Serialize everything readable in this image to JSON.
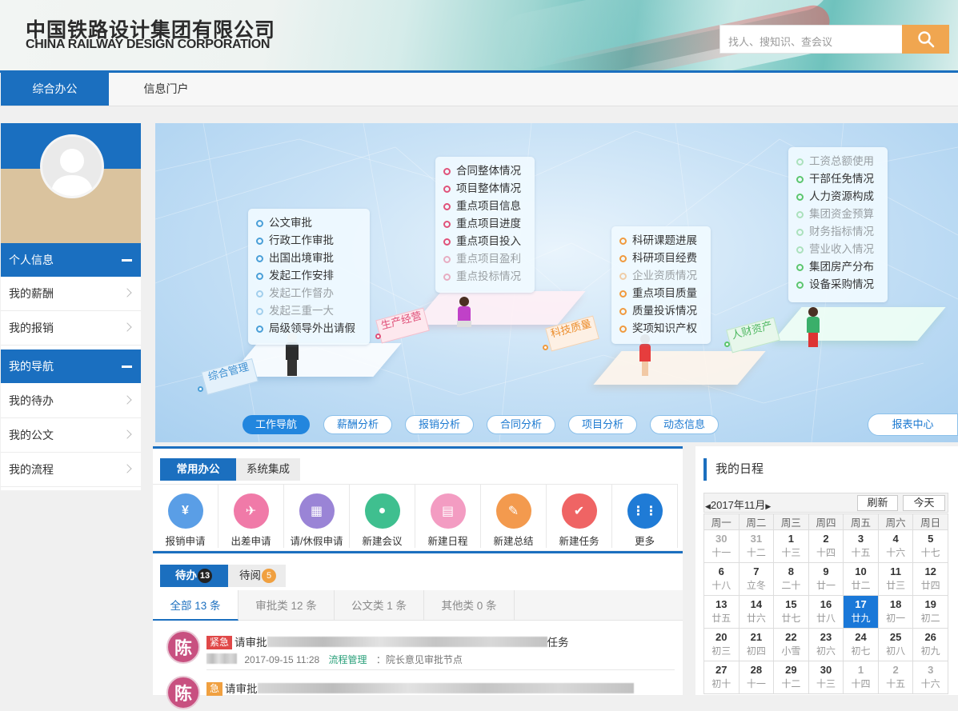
{
  "header": {
    "logo_cn": "中国铁路设计集团有限公司",
    "logo_en": "CHINA RAILWAY DESIGN CORPORATION",
    "search_placeholder": "找人、搜知识、查会议"
  },
  "nav": {
    "tabs": [
      "综合办公",
      "信息门户"
    ]
  },
  "sidebar": {
    "personal_title": "个人信息",
    "personal_items": [
      "我的薪酬",
      "我的报销"
    ],
    "nav_title": "我的导航",
    "nav_items": [
      "我的待办",
      "我的公文",
      "我的流程"
    ]
  },
  "banner": {
    "zones": [
      {
        "label": "综合管理",
        "color": "#4a9fd8",
        "items": [
          {
            "text": "公文审批",
            "faded": false
          },
          {
            "text": "行政工作审批",
            "faded": false
          },
          {
            "text": "出国出境审批",
            "faded": false
          },
          {
            "text": "发起工作安排",
            "faded": false
          },
          {
            "text": "发起工作督办",
            "faded": true
          },
          {
            "text": "发起三重一大",
            "faded": true
          },
          {
            "text": "局级领导外出请假",
            "faded": false
          }
        ]
      },
      {
        "label": "生产经营",
        "color": "#e0527a",
        "items": [
          {
            "text": "合同整体情况",
            "faded": false
          },
          {
            "text": "项目整体情况",
            "faded": false
          },
          {
            "text": "重点项目信息",
            "faded": false
          },
          {
            "text": "重点项目进度",
            "faded": false
          },
          {
            "text": "重点项目投入",
            "faded": false
          },
          {
            "text": "重点项目盈利",
            "faded": true
          },
          {
            "text": "重点投标情况",
            "faded": true
          }
        ]
      },
      {
        "label": "科技质量",
        "color": "#f09a3e",
        "items": [
          {
            "text": "科研课题进展",
            "faded": false
          },
          {
            "text": "科研项目经费",
            "faded": false
          },
          {
            "text": "企业资质情况",
            "faded": true
          },
          {
            "text": "重点项目质量",
            "faded": false
          },
          {
            "text": "质量投诉情况",
            "faded": false
          },
          {
            "text": "奖项知识产权",
            "faded": false
          }
        ]
      },
      {
        "label": "人财资产",
        "color": "#5cc66e",
        "items": [
          {
            "text": "工资总额使用",
            "faded": true
          },
          {
            "text": "干部任免情况",
            "faded": false
          },
          {
            "text": "人力资源构成",
            "faded": false
          },
          {
            "text": "集团资金预算",
            "faded": true
          },
          {
            "text": "财务指标情况",
            "faded": true
          },
          {
            "text": "营业收入情况",
            "faded": true
          },
          {
            "text": "集团房产分布",
            "faded": false
          },
          {
            "text": "设备采购情况",
            "faded": false
          }
        ]
      }
    ],
    "tabs": [
      "工作导航",
      "薪酬分析",
      "报销分析",
      "合同分析",
      "项目分析",
      "动态信息",
      "报表中心"
    ]
  },
  "office": {
    "tabs": [
      "常用办公",
      "系统集成"
    ],
    "actions": [
      {
        "label": "报销申请",
        "icon": "reimbursement-icon",
        "glyph": "¥",
        "color": "#5a9ee6"
      },
      {
        "label": "出差申请",
        "icon": "airplane-icon",
        "glyph": "✈",
        "color": "#f07aa8"
      },
      {
        "label": "请/休假申请",
        "icon": "calendar-leave-icon",
        "glyph": "▦",
        "color": "#9a84d6"
      },
      {
        "label": "新建会议",
        "icon": "meeting-icon",
        "glyph": "●",
        "color": "#3fbf8f"
      },
      {
        "label": "新建日程",
        "icon": "schedule-icon",
        "glyph": "▤",
        "color": "#f39cc2"
      },
      {
        "label": "新建总结",
        "icon": "summary-icon",
        "glyph": "✎",
        "color": "#f39a4e"
      },
      {
        "label": "新建任务",
        "icon": "task-icon",
        "glyph": "✔",
        "color": "#ef6464"
      },
      {
        "label": "更多",
        "icon": "more-grid-icon",
        "glyph": "⋮⋮",
        "color": "#1f7bd6"
      }
    ]
  },
  "todo": {
    "tabs": [
      {
        "label": "待办",
        "count": "13"
      },
      {
        "label": "待阅",
        "count": "5"
      }
    ],
    "filters": [
      "全部 13 条",
      "审批类 12 条",
      "公文类 1 条",
      "其他类 0 条"
    ],
    "items": [
      {
        "avatar": "陈",
        "tag": "紧急",
        "tag_color": "#e04848",
        "title_prefix": "请审批",
        "title_suffix": "任务",
        "date": "2017-09-15 11:28",
        "category": "流程管理",
        "node": "：院长意见审批节点"
      },
      {
        "avatar": "陈",
        "tag": "急",
        "tag_color": "#f0a040",
        "title_prefix": "请审批",
        "title_suffix": "",
        "date": "",
        "category": "",
        "node": ""
      }
    ]
  },
  "schedule": {
    "title": "我的日程",
    "month": "2017年11月",
    "refresh_label": "刷新",
    "today_label": "今天",
    "weekdays": [
      "周一",
      "周二",
      "周三",
      "周四",
      "周五",
      "周六",
      "周日"
    ],
    "weeks": [
      [
        {
          "d": "30",
          "l": "十一",
          "o": true
        },
        {
          "d": "31",
          "l": "十二",
          "o": true
        },
        {
          "d": "1",
          "l": "十三"
        },
        {
          "d": "2",
          "l": "十四"
        },
        {
          "d": "3",
          "l": "十五"
        },
        {
          "d": "4",
          "l": "十六"
        },
        {
          "d": "5",
          "l": "十七"
        }
      ],
      [
        {
          "d": "6",
          "l": "十八"
        },
        {
          "d": "7",
          "l": "立冬"
        },
        {
          "d": "8",
          "l": "二十"
        },
        {
          "d": "9",
          "l": "廿一"
        },
        {
          "d": "10",
          "l": "廿二"
        },
        {
          "d": "11",
          "l": "廿三"
        },
        {
          "d": "12",
          "l": "廿四"
        }
      ],
      [
        {
          "d": "13",
          "l": "廿五"
        },
        {
          "d": "14",
          "l": "廿六"
        },
        {
          "d": "15",
          "l": "廿七"
        },
        {
          "d": "16",
          "l": "廿八"
        },
        {
          "d": "17",
          "l": "廿九",
          "t": true
        },
        {
          "d": "18",
          "l": "初一"
        },
        {
          "d": "19",
          "l": "初二"
        }
      ],
      [
        {
          "d": "20",
          "l": "初三"
        },
        {
          "d": "21",
          "l": "初四"
        },
        {
          "d": "22",
          "l": "小雪"
        },
        {
          "d": "23",
          "l": "初六"
        },
        {
          "d": "24",
          "l": "初七"
        },
        {
          "d": "25",
          "l": "初八"
        },
        {
          "d": "26",
          "l": "初九"
        }
      ],
      [
        {
          "d": "27",
          "l": "初十"
        },
        {
          "d": "28",
          "l": "十一"
        },
        {
          "d": "29",
          "l": "十二"
        },
        {
          "d": "30",
          "l": "十三"
        },
        {
          "d": "1",
          "l": "十四",
          "o": true
        },
        {
          "d": "2",
          "l": "十五",
          "o": true
        },
        {
          "d": "3",
          "l": "十六",
          "o": true
        }
      ]
    ]
  }
}
